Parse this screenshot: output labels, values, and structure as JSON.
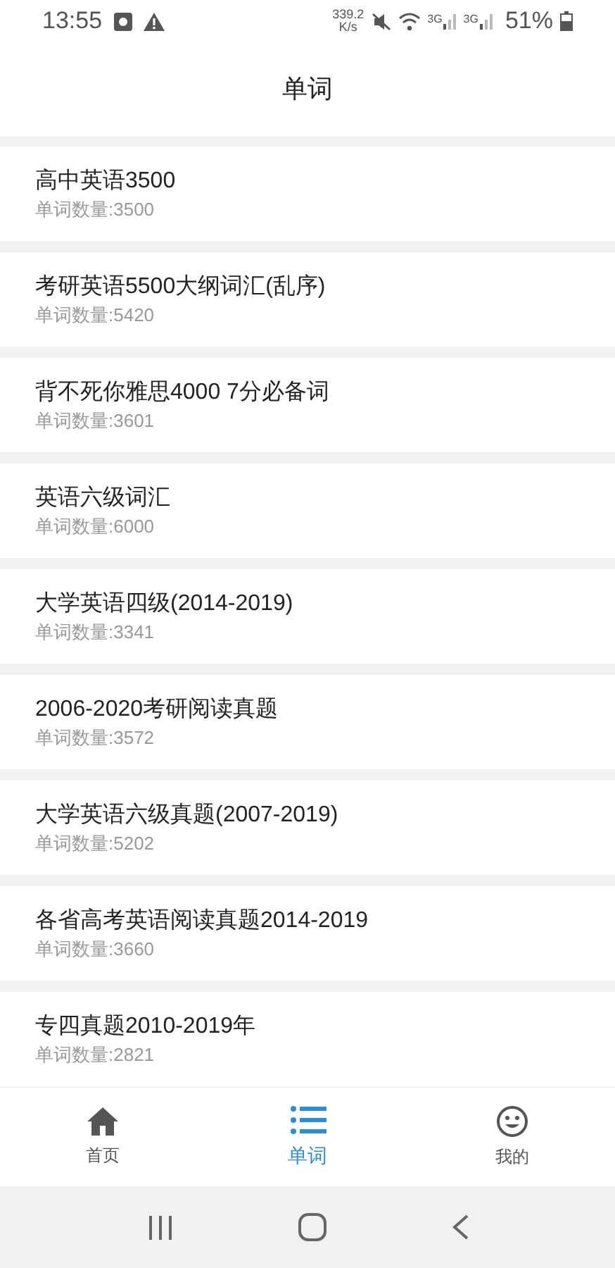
{
  "status_bar": {
    "time": "13:55",
    "speed_value": "339.2",
    "speed_unit": "K/s",
    "network_labels": [
      "3G",
      "3G"
    ],
    "battery": "51%"
  },
  "header": {
    "title": "单词"
  },
  "word_lists": [
    {
      "name": "高中英语3500",
      "count": "单词数量:3500"
    },
    {
      "name": "考研英语5500大纲词汇(乱序)",
      "count": "单词数量:5420"
    },
    {
      "name": "背不死你雅思4000 7分必备词",
      "count": "单词数量:3601"
    },
    {
      "name": "英语六级词汇",
      "count": "单词数量:6000"
    },
    {
      "name": "大学英语四级(2014-2019)",
      "count": "单词数量:3341"
    },
    {
      "name": "2006-2020考研阅读真题",
      "count": "单词数量:3572"
    },
    {
      "name": "大学英语六级真题(2007-2019)",
      "count": "单词数量:5202"
    },
    {
      "name": "各省高考英语阅读真题2014-2019",
      "count": "单词数量:3660"
    },
    {
      "name": "专四真题2010-2019年",
      "count": "单词数量:2821"
    }
  ],
  "bottom_nav": [
    {
      "label": "首页",
      "kind": "home",
      "selected": false
    },
    {
      "label": "单词",
      "kind": "list",
      "selected": true
    },
    {
      "label": "我的",
      "kind": "smile",
      "selected": false
    }
  ]
}
